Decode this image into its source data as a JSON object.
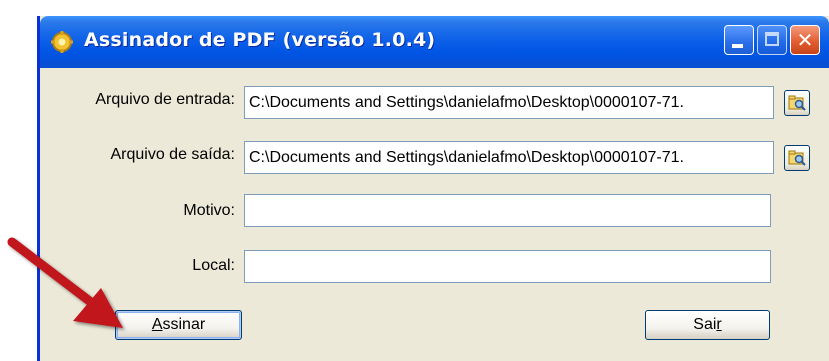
{
  "window": {
    "title": "Assinador de PDF (versão 1.0.4)",
    "icon": "app-gear-icon",
    "controls": {
      "minimize": "minimize-icon",
      "maximize": "maximize-icon",
      "close": "close-icon"
    }
  },
  "form": {
    "input_file": {
      "label": "Arquivo de entrada:",
      "value": "C:\\Documents and Settings\\danielafmo\\Desktop\\0000107-71.",
      "browse_icon": "browse-folder-icon"
    },
    "output_file": {
      "label": "Arquivo de saída:",
      "value": "C:\\Documents and Settings\\danielafmo\\Desktop\\0000107-71.",
      "browse_icon": "browse-folder-icon"
    },
    "reason": {
      "label": "Motivo:",
      "value": ""
    },
    "location": {
      "label": "Local:",
      "value": ""
    }
  },
  "buttons": {
    "sign": {
      "mnemonic": "A",
      "rest": "ssinar"
    },
    "exit": {
      "before": "Sai",
      "mnemonic": "r"
    }
  },
  "annotation": {
    "arrow_color": "#c0141c",
    "arrow_icon": "red-pointer-arrow"
  },
  "colors": {
    "titlebar": "#0054e3",
    "window_bg": "#ece9d8",
    "field_border": "#7f9db9"
  }
}
